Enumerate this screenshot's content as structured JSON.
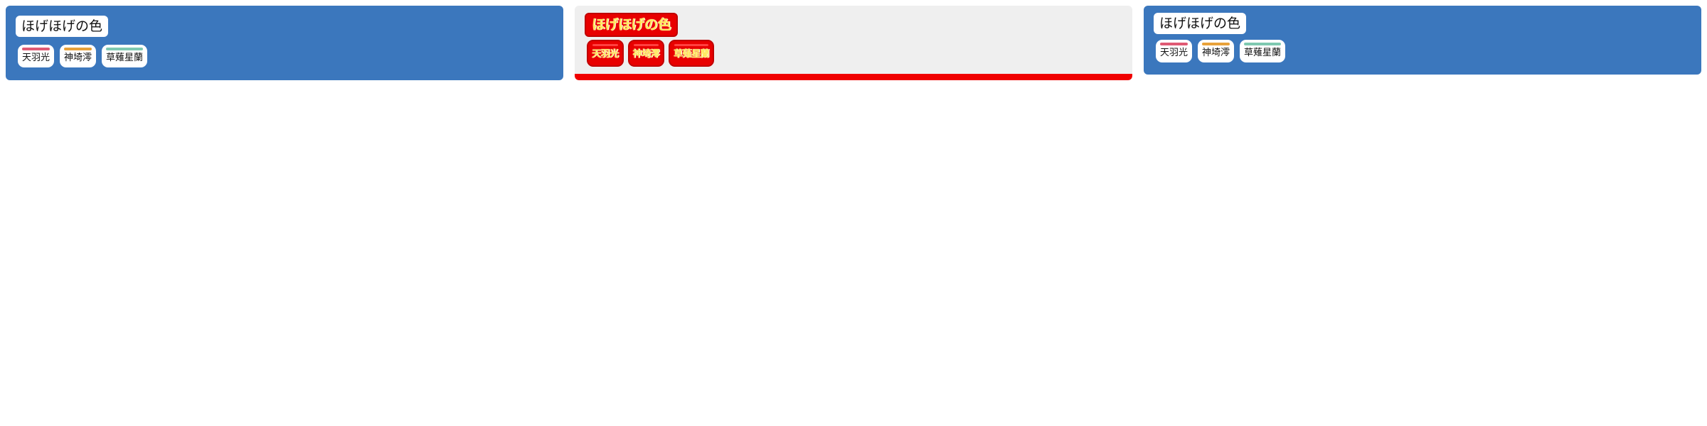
{
  "cards": [
    {
      "title": "ほげほげの色",
      "tags": [
        {
          "label": "天羽光",
          "color": "#e05a74"
        },
        {
          "label": "神埼澪",
          "color": "#e8a23a"
        },
        {
          "label": "草薙星蘭",
          "color": "#7ec9b0"
        }
      ]
    },
    {
      "title": "ほげほげの色",
      "tags": [
        {
          "label": "天羽光",
          "color": "#e05a74"
        },
        {
          "label": "神埼澪",
          "color": "#e8a23a"
        },
        {
          "label": "草薙星蘭",
          "color": "#7ec9b0"
        }
      ]
    },
    {
      "title": "ほげほげの色",
      "tags": [
        {
          "label": "天羽光",
          "color": "#e05a74"
        },
        {
          "label": "神埼澪",
          "color": "#e8a23a"
        },
        {
          "label": "草薙星蘭",
          "color": "#7ec9b0"
        }
      ]
    }
  ],
  "colors": {
    "panel_blue": "#3b77bd",
    "panel_grey": "#efefef",
    "alert_red": "#e80000"
  }
}
